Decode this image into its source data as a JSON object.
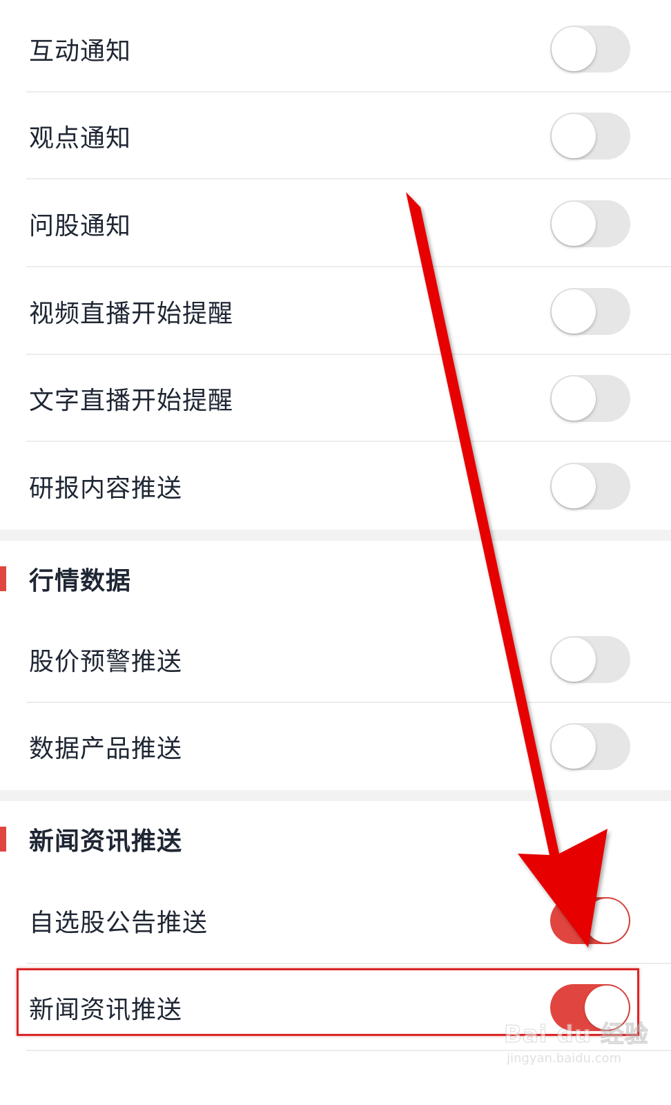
{
  "settings": {
    "rows_top": [
      {
        "label": "互动通知",
        "enabled": false
      },
      {
        "label": "观点通知",
        "enabled": false
      },
      {
        "label": "问股通知",
        "enabled": false
      },
      {
        "label": "视频直播开始提醒",
        "enabled": false
      },
      {
        "label": "文字直播开始提醒",
        "enabled": false
      },
      {
        "label": "研报内容推送",
        "enabled": false
      }
    ],
    "section_market": {
      "title": "行情数据",
      "rows": [
        {
          "label": "股价预警推送",
          "enabled": false
        },
        {
          "label": "数据产品推送",
          "enabled": false
        }
      ]
    },
    "section_news": {
      "title": "新闻资讯推送",
      "rows": [
        {
          "label": "自选股公告推送",
          "enabled": true
        },
        {
          "label": "新闻资讯推送",
          "enabled": true
        }
      ]
    }
  },
  "colors": {
    "accent": "#e0453f",
    "toggle_off": "#e6e6e6",
    "annotation_red": "#e60000"
  },
  "watermark": {
    "line1": "Bai du 经验",
    "line2": "jingyan.baidu.com"
  }
}
